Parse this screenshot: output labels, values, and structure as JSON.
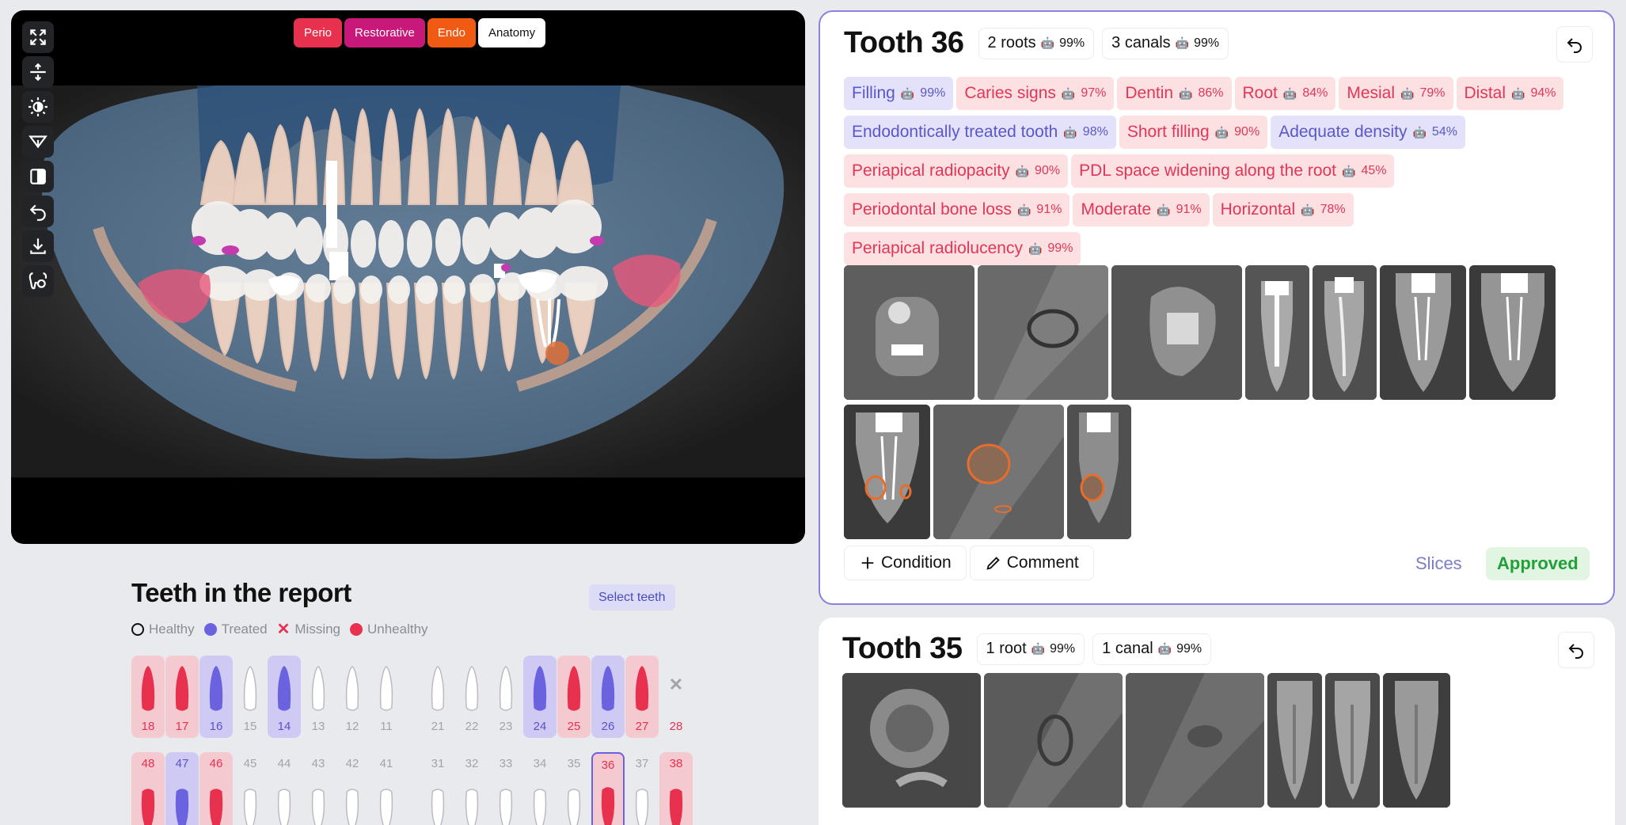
{
  "viewer": {
    "tabs": [
      {
        "label": "Perio",
        "color": "#e8304f"
      },
      {
        "label": "Restorative",
        "color": "#c8187a"
      },
      {
        "label": "Endo",
        "color": "#f05a12"
      },
      {
        "label": "Anatomy",
        "color": "#ffffff"
      }
    ],
    "tools": [
      "expand-icon",
      "split-view-icon",
      "brightness-icon",
      "filter-icon",
      "invert-icon",
      "undo-icon",
      "download-icon",
      "tooth-mask-icon"
    ]
  },
  "teeth_report": {
    "title": "Teeth in the report",
    "select_label": "Select teeth",
    "legend": [
      {
        "label": "Healthy",
        "color": "#ffffff"
      },
      {
        "label": "Treated",
        "color": "#6b62e0"
      },
      {
        "label": "Missing",
        "color": "#e8304f"
      },
      {
        "label": "Unhealthy",
        "color": "#e8304f"
      }
    ],
    "upper": [
      {
        "num": "18",
        "status": "unhealthy"
      },
      {
        "num": "17",
        "status": "unhealthy"
      },
      {
        "num": "16",
        "status": "treated"
      },
      {
        "num": "15",
        "status": "healthy"
      },
      {
        "num": "14",
        "status": "treated"
      },
      {
        "num": "13",
        "status": "healthy"
      },
      {
        "num": "12",
        "status": "healthy"
      },
      {
        "num": "11",
        "status": "healthy"
      },
      {
        "num": "21",
        "status": "healthy"
      },
      {
        "num": "22",
        "status": "healthy"
      },
      {
        "num": "23",
        "status": "healthy"
      },
      {
        "num": "24",
        "status": "treated"
      },
      {
        "num": "25",
        "status": "unhealthy"
      },
      {
        "num": "26",
        "status": "treated"
      },
      {
        "num": "27",
        "status": "unhealthy"
      },
      {
        "num": "28",
        "status": "missing"
      }
    ],
    "lower": [
      {
        "num": "48",
        "status": "unhealthy"
      },
      {
        "num": "47",
        "status": "treated"
      },
      {
        "num": "46",
        "status": "unhealthy"
      },
      {
        "num": "45",
        "status": "healthy"
      },
      {
        "num": "44",
        "status": "healthy"
      },
      {
        "num": "43",
        "status": "healthy"
      },
      {
        "num": "42",
        "status": "healthy"
      },
      {
        "num": "41",
        "status": "healthy"
      },
      {
        "num": "31",
        "status": "healthy"
      },
      {
        "num": "32",
        "status": "healthy"
      },
      {
        "num": "33",
        "status": "healthy"
      },
      {
        "num": "34",
        "status": "healthy"
      },
      {
        "num": "35",
        "status": "healthy"
      },
      {
        "num": "36",
        "status": "selected"
      },
      {
        "num": "37",
        "status": "healthy"
      },
      {
        "num": "38",
        "status": "unhealthy"
      }
    ]
  },
  "card36": {
    "title": "Tooth 36",
    "roots": "2 roots",
    "roots_pct": "99%",
    "canals": "3 canals",
    "canals_pct": "99%",
    "conditions": [
      {
        "label": "Filling",
        "pct": "99%",
        "kind": "purple"
      },
      {
        "label": "Caries signs",
        "pct": "97%",
        "kind": "red"
      },
      {
        "label": "Dentin",
        "pct": "86%",
        "kind": "red"
      },
      {
        "label": "Root",
        "pct": "84%",
        "kind": "red"
      },
      {
        "label": "Mesial",
        "pct": "79%",
        "kind": "red"
      },
      {
        "label": "Distal",
        "pct": "94%",
        "kind": "red"
      },
      {
        "label": "Endodontically treated tooth",
        "pct": "98%",
        "kind": "purple"
      },
      {
        "label": "Short filling",
        "pct": "90%",
        "kind": "red"
      },
      {
        "label": "Adequate density",
        "pct": "54%",
        "kind": "purple"
      },
      {
        "label": "Periapical radiopacity",
        "pct": "90%",
        "kind": "red"
      },
      {
        "label": "PDL space widening along the root",
        "pct": "45%",
        "kind": "red"
      },
      {
        "label": "Periodontal bone loss",
        "pct": "91%",
        "kind": "red"
      },
      {
        "label": "Moderate",
        "pct": "91%",
        "kind": "red"
      },
      {
        "label": "Horizontal",
        "pct": "78%",
        "kind": "red"
      },
      {
        "label": "Periapical radiolucency",
        "pct": "99%",
        "kind": "red"
      }
    ],
    "condition_btn": "Condition",
    "comment_btn": "Comment",
    "slices_link": "Slices",
    "approved": "Approved"
  },
  "card35": {
    "title": "Tooth 35",
    "roots": "1 root",
    "roots_pct": "99%",
    "canals": "1 canal",
    "canals_pct": "99%"
  }
}
